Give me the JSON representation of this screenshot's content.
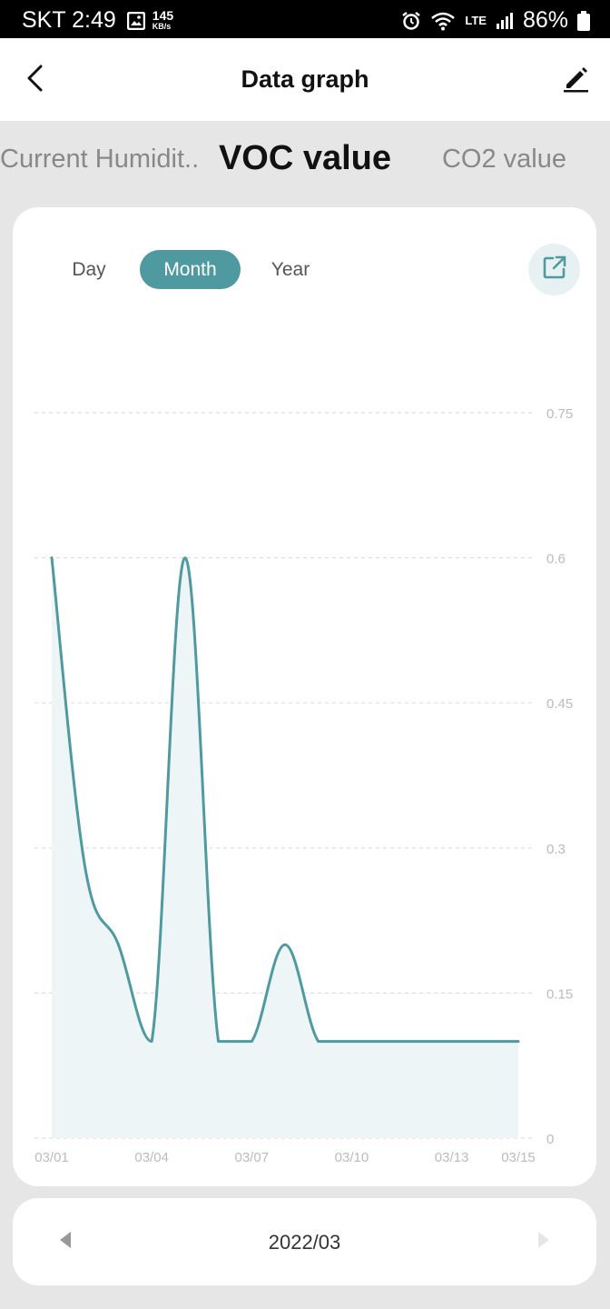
{
  "status_bar": {
    "carrier_time": "SKT 2:49",
    "speed_value": "145",
    "speed_unit": "KB/s",
    "network": "LTE",
    "battery": "86%"
  },
  "header": {
    "title": "Data graph"
  },
  "metric_tabs": [
    {
      "label": "Current Humidit.."
    },
    {
      "label": "VOC value"
    },
    {
      "label": "CO2 value"
    }
  ],
  "range_tabs": [
    {
      "label": "Day"
    },
    {
      "label": "Month"
    },
    {
      "label": "Year"
    }
  ],
  "period": {
    "label": "2022/03"
  },
  "colors": {
    "accent": "#4f9aa0",
    "fill": "#eef5f7",
    "grid": "#dddddd",
    "tick": "#bbbbbb"
  },
  "icons": [
    "image-icon",
    "alarm-icon",
    "wifi-icon",
    "signal-icon",
    "battery-icon",
    "back-arrow-icon",
    "edit-pencil-icon",
    "export-icon",
    "prev-arrow-icon",
    "next-arrow-icon"
  ],
  "chart_data": {
    "type": "area",
    "x": [
      "03/01",
      "03/02",
      "03/03",
      "03/04",
      "03/05",
      "03/06",
      "03/07",
      "03/08",
      "03/09",
      "03/10",
      "03/11",
      "03/12",
      "03/13",
      "03/14",
      "03/15"
    ],
    "values": [
      0.6,
      0.28,
      0.2,
      0.1,
      0.6,
      0.1,
      0.1,
      0.2,
      0.1,
      0.1,
      0.1,
      0.1,
      0.1,
      0.1,
      0.1
    ],
    "x_tick_labels": [
      "03/01",
      "03/04",
      "03/07",
      "03/10",
      "03/13",
      "03/15"
    ],
    "y_ticks": [
      "0",
      "0.15",
      "0.3",
      "0.45",
      "0.6",
      "0.75"
    ],
    "ylim": [
      0,
      0.75
    ],
    "grid": true,
    "y_axis_side": "right"
  }
}
